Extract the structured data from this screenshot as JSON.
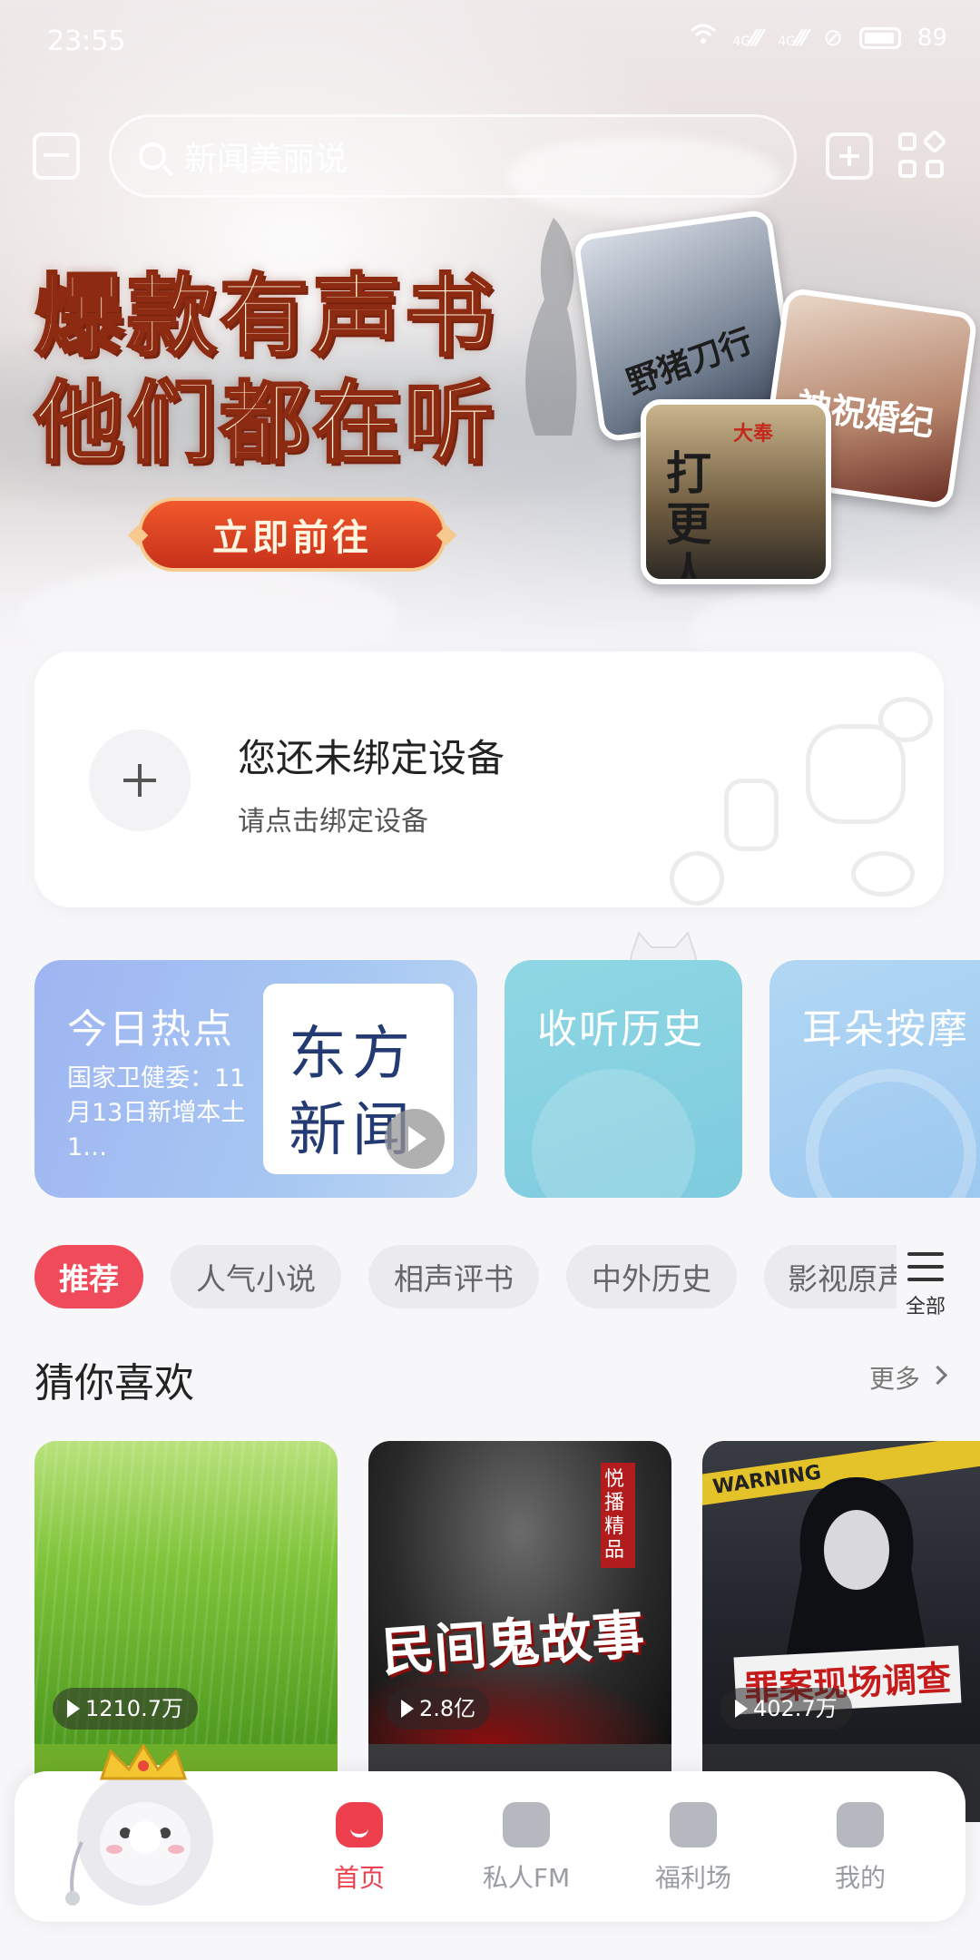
{
  "status_bar": {
    "time": "23:55",
    "signal_1": "4G",
    "signal_2": "4G",
    "battery": "89"
  },
  "search": {
    "placeholder": "新闻美丽说"
  },
  "banner": {
    "line1": "爆款有声书",
    "line2": "他们都在听",
    "cta": "立即前往",
    "covers": [
      {
        "title": "野猪刀行"
      },
      {
        "title": "神祝婚纪"
      },
      {
        "title": "打更人",
        "tag": "大奉"
      }
    ]
  },
  "device_card": {
    "title": "您还未绑定设备",
    "subtitle": "请点击绑定设备"
  },
  "quick_cards": [
    {
      "label": "今日热点",
      "desc": "国家卫健委：11月13日新增本土1…",
      "thumb_text_1": "东方",
      "thumb_text_2": "新闻"
    },
    {
      "label": "收听历史"
    },
    {
      "label": "耳朵按摩"
    }
  ],
  "categories": [
    "推荐",
    "人气小说",
    "相声评书",
    "中外历史",
    "影视原声"
  ],
  "categories_all": "全部",
  "section": {
    "title": "猜你喜欢",
    "more": "更多"
  },
  "recommendations": [
    {
      "plays": "1210.7万",
      "color": "#6fae2a"
    },
    {
      "plays": "2.8亿",
      "title": "民间鬼故事",
      "tag": "悦播精品"
    },
    {
      "plays": "402.7万",
      "title": "罪案现场调查",
      "banner_text": "WARNING"
    }
  ],
  "nav": [
    {
      "label": "首页",
      "icon": "home-icon",
      "active": true
    },
    {
      "label": "私人FM",
      "icon": "radio-icon"
    },
    {
      "label": "福利场",
      "icon": "gift-icon"
    },
    {
      "label": "我的",
      "icon": "profile-icon"
    }
  ],
  "colors": {
    "accent": "#ee3f4f",
    "chip_active": "#f04b5a",
    "background": "#f7f6f9"
  }
}
